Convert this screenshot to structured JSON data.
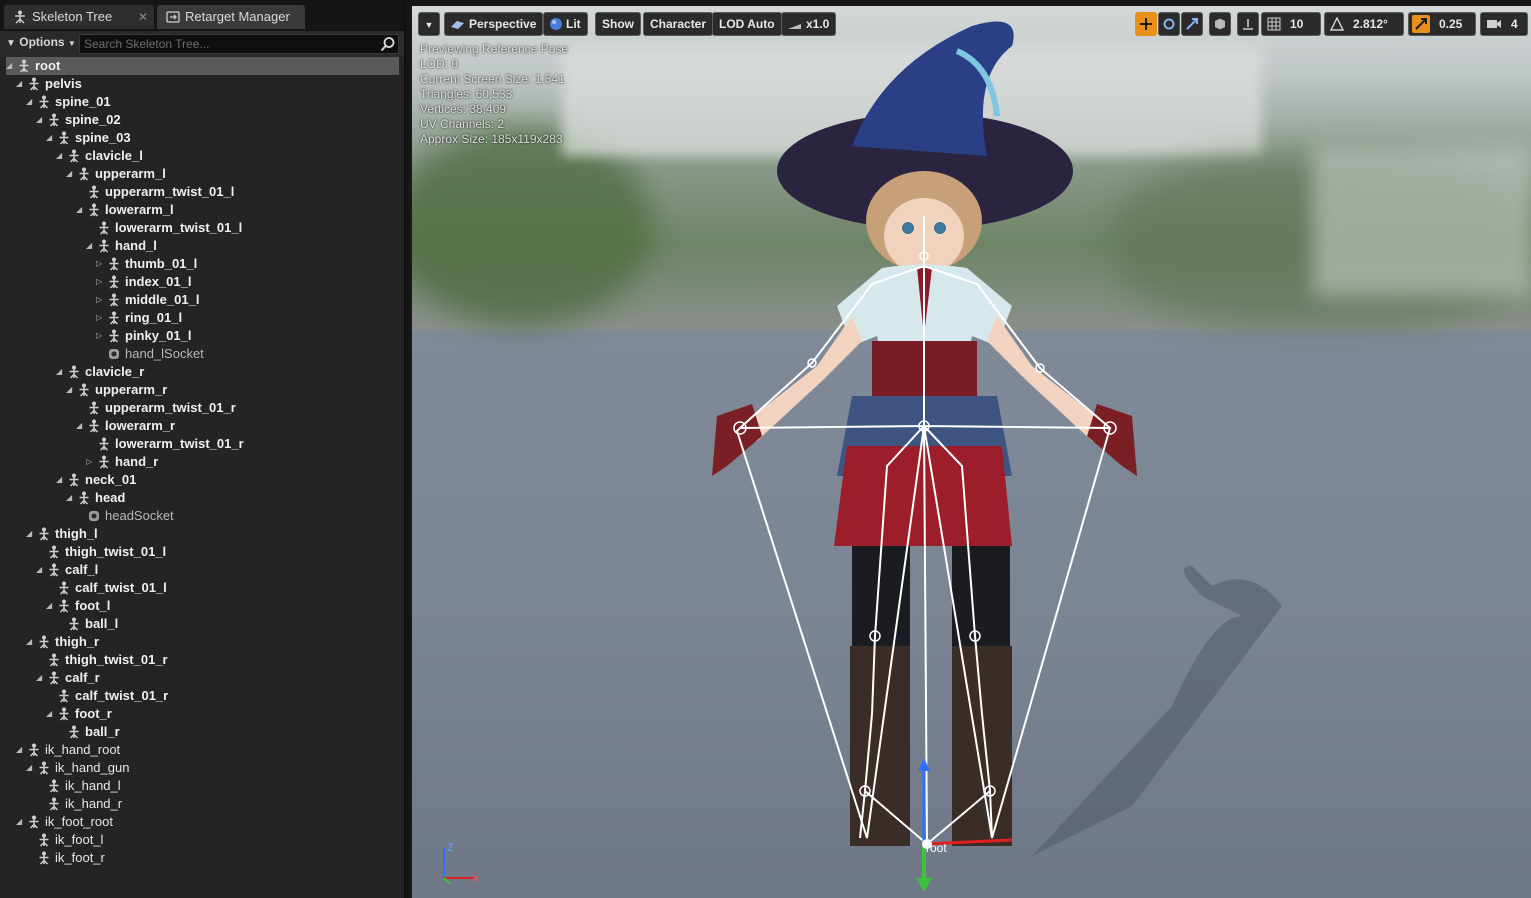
{
  "tabs": {
    "skeleton_tree": "Skeleton Tree",
    "retarget_manager": "Retarget Manager"
  },
  "left_toolbar": {
    "options_label": "Options",
    "search_placeholder": "Search Skeleton Tree..."
  },
  "tree": [
    {
      "label": "root",
      "depth": 0,
      "kind": "bone",
      "exp": "open",
      "bold": true
    },
    {
      "label": "pelvis",
      "depth": 1,
      "kind": "bone",
      "exp": "open",
      "bold": true
    },
    {
      "label": "spine_01",
      "depth": 2,
      "kind": "bone",
      "exp": "open",
      "bold": true
    },
    {
      "label": "spine_02",
      "depth": 3,
      "kind": "bone",
      "exp": "open",
      "bold": true
    },
    {
      "label": "spine_03",
      "depth": 4,
      "kind": "bone",
      "exp": "open",
      "bold": true
    },
    {
      "label": "clavicle_l",
      "depth": 5,
      "kind": "bone",
      "exp": "open",
      "bold": true
    },
    {
      "label": "upperarm_l",
      "depth": 6,
      "kind": "bone",
      "exp": "open",
      "bold": true
    },
    {
      "label": "upperarm_twist_01_l",
      "depth": 7,
      "kind": "bone",
      "exp": "none",
      "bold": true
    },
    {
      "label": "lowerarm_l",
      "depth": 7,
      "kind": "bone",
      "exp": "open",
      "bold": true
    },
    {
      "label": "lowerarm_twist_01_l",
      "depth": 8,
      "kind": "bone",
      "exp": "none",
      "bold": true
    },
    {
      "label": "hand_l",
      "depth": 8,
      "kind": "bone",
      "exp": "open",
      "bold": true
    },
    {
      "label": "thumb_01_l",
      "depth": 9,
      "kind": "bone",
      "exp": "closed",
      "bold": true
    },
    {
      "label": "index_01_l",
      "depth": 9,
      "kind": "bone",
      "exp": "closed",
      "bold": true
    },
    {
      "label": "middle_01_l",
      "depth": 9,
      "kind": "bone",
      "exp": "closed",
      "bold": true
    },
    {
      "label": "ring_01_l",
      "depth": 9,
      "kind": "bone",
      "exp": "closed",
      "bold": true
    },
    {
      "label": "pinky_01_l",
      "depth": 9,
      "kind": "bone",
      "exp": "closed",
      "bold": true
    },
    {
      "label": "hand_lSocket",
      "depth": 9,
      "kind": "socket",
      "exp": "none",
      "bold": false
    },
    {
      "label": "clavicle_r",
      "depth": 5,
      "kind": "bone",
      "exp": "open",
      "bold": true
    },
    {
      "label": "upperarm_r",
      "depth": 6,
      "kind": "bone",
      "exp": "open",
      "bold": true
    },
    {
      "label": "upperarm_twist_01_r",
      "depth": 7,
      "kind": "bone",
      "exp": "none",
      "bold": true
    },
    {
      "label": "lowerarm_r",
      "depth": 7,
      "kind": "bone",
      "exp": "open",
      "bold": true
    },
    {
      "label": "lowerarm_twist_01_r",
      "depth": 8,
      "kind": "bone",
      "exp": "none",
      "bold": true
    },
    {
      "label": "hand_r",
      "depth": 8,
      "kind": "bone",
      "exp": "closed",
      "bold": true
    },
    {
      "label": "neck_01",
      "depth": 5,
      "kind": "bone",
      "exp": "open",
      "bold": true
    },
    {
      "label": "head",
      "depth": 6,
      "kind": "bone",
      "exp": "open",
      "bold": true
    },
    {
      "label": "headSocket",
      "depth": 7,
      "kind": "socket",
      "exp": "none",
      "bold": false
    },
    {
      "label": "thigh_l",
      "depth": 2,
      "kind": "bone",
      "exp": "open",
      "bold": true
    },
    {
      "label": "thigh_twist_01_l",
      "depth": 3,
      "kind": "bone",
      "exp": "none",
      "bold": true
    },
    {
      "label": "calf_l",
      "depth": 3,
      "kind": "bone",
      "exp": "open",
      "bold": true
    },
    {
      "label": "calf_twist_01_l",
      "depth": 4,
      "kind": "bone",
      "exp": "none",
      "bold": true
    },
    {
      "label": "foot_l",
      "depth": 4,
      "kind": "bone",
      "exp": "open",
      "bold": true
    },
    {
      "label": "ball_l",
      "depth": 5,
      "kind": "bone",
      "exp": "none",
      "bold": true
    },
    {
      "label": "thigh_r",
      "depth": 2,
      "kind": "bone",
      "exp": "open",
      "bold": true
    },
    {
      "label": "thigh_twist_01_r",
      "depth": 3,
      "kind": "bone",
      "exp": "none",
      "bold": true
    },
    {
      "label": "calf_r",
      "depth": 3,
      "kind": "bone",
      "exp": "open",
      "bold": true
    },
    {
      "label": "calf_twist_01_r",
      "depth": 4,
      "kind": "bone",
      "exp": "none",
      "bold": true
    },
    {
      "label": "foot_r",
      "depth": 4,
      "kind": "bone",
      "exp": "open",
      "bold": true
    },
    {
      "label": "ball_r",
      "depth": 5,
      "kind": "bone",
      "exp": "none",
      "bold": true
    },
    {
      "label": "ik_hand_root",
      "depth": 1,
      "kind": "bone",
      "exp": "open",
      "bold": false
    },
    {
      "label": "ik_hand_gun",
      "depth": 2,
      "kind": "bone",
      "exp": "open",
      "bold": false
    },
    {
      "label": "ik_hand_l",
      "depth": 3,
      "kind": "bone",
      "exp": "none",
      "bold": false
    },
    {
      "label": "ik_hand_r",
      "depth": 3,
      "kind": "bone",
      "exp": "none",
      "bold": false
    },
    {
      "label": "ik_foot_root",
      "depth": 1,
      "kind": "bone",
      "exp": "open",
      "bold": false
    },
    {
      "label": "ik_foot_l",
      "depth": 2,
      "kind": "bone",
      "exp": "none",
      "bold": false
    },
    {
      "label": "ik_foot_r",
      "depth": 2,
      "kind": "bone",
      "exp": "none",
      "bold": false
    }
  ],
  "viewport_toolbar": {
    "perspective": "Perspective",
    "lit": "Lit",
    "show": "Show",
    "character": "Character",
    "lod": "LOD Auto",
    "speed": "x1.0",
    "grid_size": "10",
    "rot_snap": "2.812°",
    "scale_snap": "0.25",
    "camera_speed": "4"
  },
  "viewport_info": [
    "Previewing Reference Pose",
    "LOD: 0",
    "Current Screen Size: 1.541",
    "Triangles: 60,533",
    "Vertices: 38,409",
    "UV Channels: 2",
    "Approx Size: 185x119x283"
  ],
  "viewport_labels": {
    "root_bone": "root",
    "axis_z": "Z",
    "axis_x": "X",
    "axis_y": "Y"
  },
  "colors": {
    "accent_orange": "#e8901a",
    "axis_red": "#e02020",
    "axis_green": "#40c040",
    "axis_blue": "#3070ff"
  }
}
